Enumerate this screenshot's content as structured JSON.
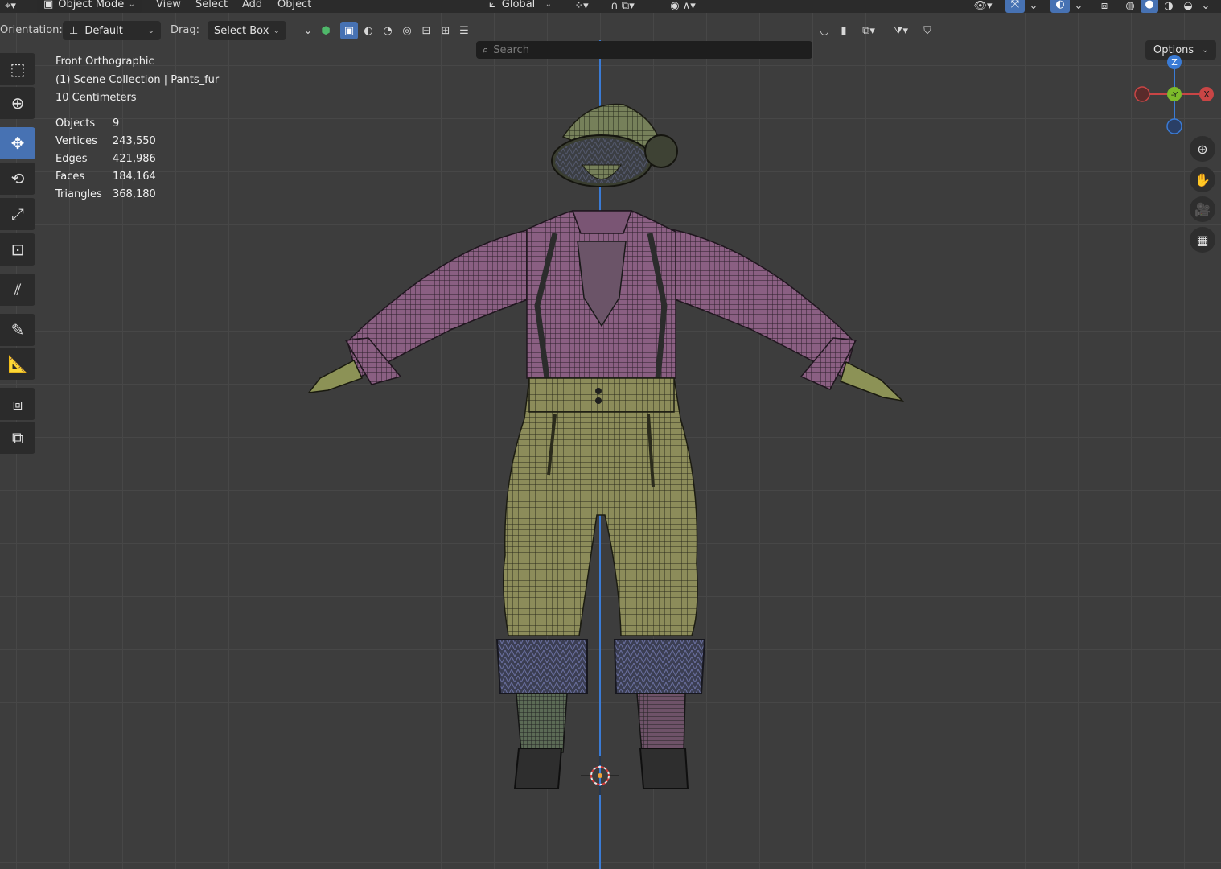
{
  "header": {
    "editor_type_icon": "editor-type-icon",
    "mode_label": "Object Mode",
    "menus": [
      "View",
      "Select",
      "Add",
      "Object"
    ],
    "transform_orientation": "Global"
  },
  "tool_settings": {
    "orientation_label": "Orientation:",
    "orientation_value": "Default",
    "drag_label": "Drag:",
    "drag_value": "Select Box",
    "search_placeholder": "Search",
    "options_label": "Options"
  },
  "overlay_info": {
    "view_name": "Front Orthographic",
    "collection": "(1) Scene Collection | Pants_fur",
    "scale": "10 Centimeters"
  },
  "stats": [
    {
      "label": "Objects",
      "value": "9"
    },
    {
      "label": "Vertices",
      "value": "243,550"
    },
    {
      "label": "Edges",
      "value": "421,986"
    },
    {
      "label": "Faces",
      "value": "184,164"
    },
    {
      "label": "Triangles",
      "value": "368,180"
    }
  ],
  "gizmo": {
    "z": "Z",
    "y": "-Y",
    "x": "X"
  },
  "colors": {
    "accent": "#4772b3",
    "axis_x": "#c94545",
    "axis_z": "#3a7bd5",
    "shirt": "#8a5f82",
    "pants": "#8c8c5a",
    "fur": "#5a5f7a"
  },
  "tools": [
    "select-box-tool",
    "cursor-tool",
    "move-tool",
    "rotate-tool",
    "scale-tool",
    "transform-tool",
    "annotate-tool",
    "measure-tool",
    "draw-tool",
    "ruler-tool",
    "add-cube-tool",
    "add-object-tool"
  ]
}
